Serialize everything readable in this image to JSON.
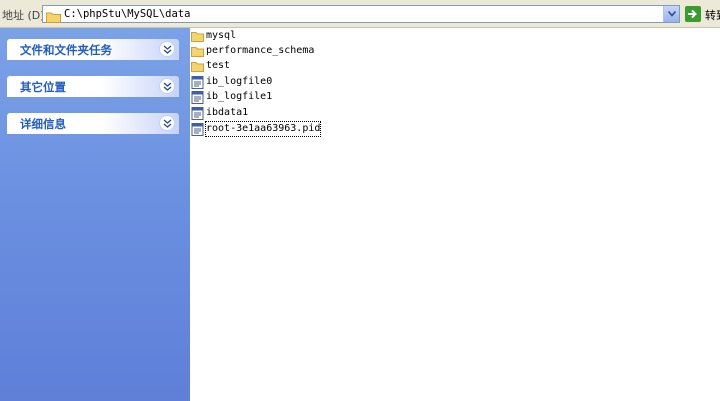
{
  "address_bar": {
    "label": "地址 (D)",
    "path": "C:\\phpStu\\MySQL\\data",
    "go_label": "转到"
  },
  "task_pane": {
    "groups": [
      {
        "title": "文件和文件夹任务"
      },
      {
        "title": "其它位置"
      },
      {
        "title": "详细信息"
      }
    ]
  },
  "files": [
    {
      "name": "mysql",
      "type": "folder"
    },
    {
      "name": "performance_schema",
      "type": "folder"
    },
    {
      "name": "test",
      "type": "folder"
    },
    {
      "name": "ib_logfile0",
      "type": "file"
    },
    {
      "name": "ib_logfile1",
      "type": "file"
    },
    {
      "name": "ibdata1",
      "type": "file"
    },
    {
      "name": "root-3e1aa63963.pid",
      "type": "file",
      "selected": true
    }
  ],
  "colors": {
    "pane_top": "#7ba2e7",
    "pane_bottom": "#5f7fd8",
    "group_title": "#215dc6",
    "folder": "#f5d56b"
  }
}
